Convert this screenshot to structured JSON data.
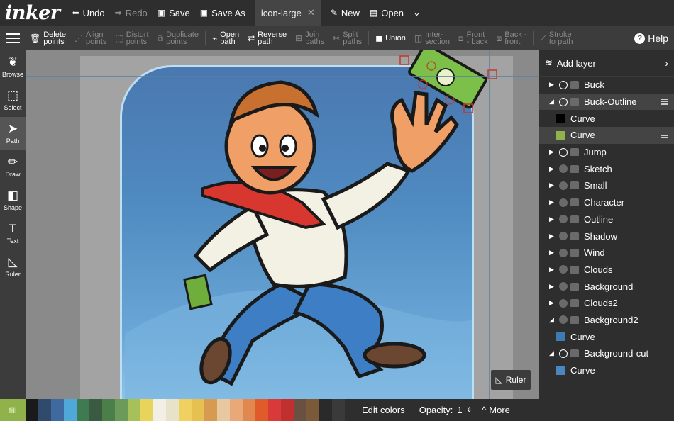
{
  "app": {
    "logo": "inker"
  },
  "topbar": {
    "undo": "Undo",
    "redo": "Redo",
    "save": "Save",
    "save_as": "Save As",
    "tab_name": "icon-large",
    "new": "New",
    "open": "Open"
  },
  "toolbar": {
    "delete_points": [
      "Delete",
      "points"
    ],
    "align_points": [
      "Align",
      "points"
    ],
    "distort_points": [
      "Distort",
      "points"
    ],
    "duplicate_points": [
      "Duplicate",
      "points"
    ],
    "open_path": [
      "Open",
      "path"
    ],
    "reverse_path": [
      "Reverse",
      "path"
    ],
    "join_paths": [
      "Join",
      "paths"
    ],
    "split_paths": [
      "Split",
      "paths"
    ],
    "union": "Union",
    "intersection": [
      "Inter-",
      "section"
    ],
    "front_back": [
      "Front",
      "- back"
    ],
    "back_front": [
      "Back -",
      "front"
    ],
    "stroke_to_path": [
      "Stroke",
      "to path"
    ],
    "help": "Help"
  },
  "tools": [
    {
      "label": "Browse",
      "icon": "leaf-icon"
    },
    {
      "label": "Select",
      "icon": "select-icon"
    },
    {
      "label": "Path",
      "icon": "pointer-icon"
    },
    {
      "label": "Draw",
      "icon": "pencil-icon"
    },
    {
      "label": "Shape",
      "icon": "shape-icon"
    },
    {
      "label": "Text",
      "icon": "text-icon"
    },
    {
      "label": "Ruler",
      "icon": "ruler-icon"
    }
  ],
  "canvas": {
    "ruler_button": "Ruler"
  },
  "layers_panel": {
    "add_layer": "Add layer",
    "layers": [
      {
        "name": "Buck"
      },
      {
        "name": "Buck-Outline"
      },
      {
        "name": "Curve",
        "swatch": "#000000"
      },
      {
        "name": "Curve",
        "swatch": "#8fb34a"
      },
      {
        "name": "Jump"
      },
      {
        "name": "Sketch"
      },
      {
        "name": "Small"
      },
      {
        "name": "Character"
      },
      {
        "name": "Outline"
      },
      {
        "name": "Shadow"
      },
      {
        "name": "Wind"
      },
      {
        "name": "Clouds"
      },
      {
        "name": "Background"
      },
      {
        "name": "Clouds2"
      },
      {
        "name": "Background2"
      },
      {
        "name": "Curve",
        "swatch": "#3f7ab3"
      },
      {
        "name": "Background-cut"
      },
      {
        "name": "Curve",
        "swatch": "#4a86c0"
      }
    ]
  },
  "bottombar": {
    "fill": "fill",
    "edit_colors": "Edit colors",
    "opacity_label": "Opacity:",
    "opacity_value": "1",
    "more": "More",
    "palette": [
      "#1a1a1a",
      "#2f4a6b",
      "#3f6aa0",
      "#4fa8d8",
      "#3f7a50",
      "#3a5a42",
      "#4a7f4a",
      "#6b9a5a",
      "#a6c15a",
      "#e8d45a",
      "#f2f0e6",
      "#e8e2c8",
      "#f0d060",
      "#e6c050",
      "#d69a50",
      "#e8c8a0",
      "#e8a878",
      "#e08850",
      "#e05a2a",
      "#d83a3a",
      "#c03030",
      "#6a5040",
      "#7a5a38",
      "#2a2a2a",
      "#3a3a3a"
    ]
  }
}
